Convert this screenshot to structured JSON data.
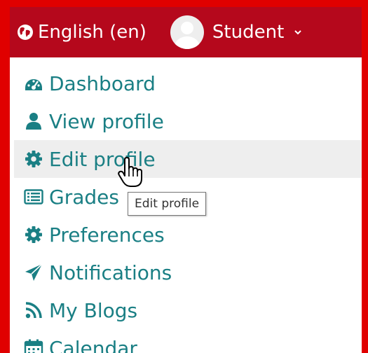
{
  "colors": {
    "navbar_bg": "#b5081c",
    "frame_red": "#e00000",
    "link_teal": "#1a7f84",
    "hover_bg": "#eeeeee"
  },
  "navbar": {
    "language_label": "English (en)",
    "language_icon": "globe-icon",
    "user_label": "Student",
    "user_caret_icon": "chevron-down-icon"
  },
  "menu": {
    "items": [
      {
        "label": "Dashboard",
        "icon": "dashboard-icon"
      },
      {
        "label": "View profile",
        "icon": "user-icon"
      },
      {
        "label": "Edit profile",
        "icon": "gear-icon",
        "hovered": true
      },
      {
        "label": "Grades",
        "icon": "grades-table-icon"
      },
      {
        "label": "Preferences",
        "icon": "gear-icon"
      },
      {
        "label": "Notifications",
        "icon": "paper-plane-icon"
      },
      {
        "label": "My Blogs",
        "icon": "rss-icon"
      },
      {
        "label": "Calendar",
        "icon": "calendar-icon"
      }
    ]
  },
  "tooltip": {
    "text": "Edit profile"
  }
}
